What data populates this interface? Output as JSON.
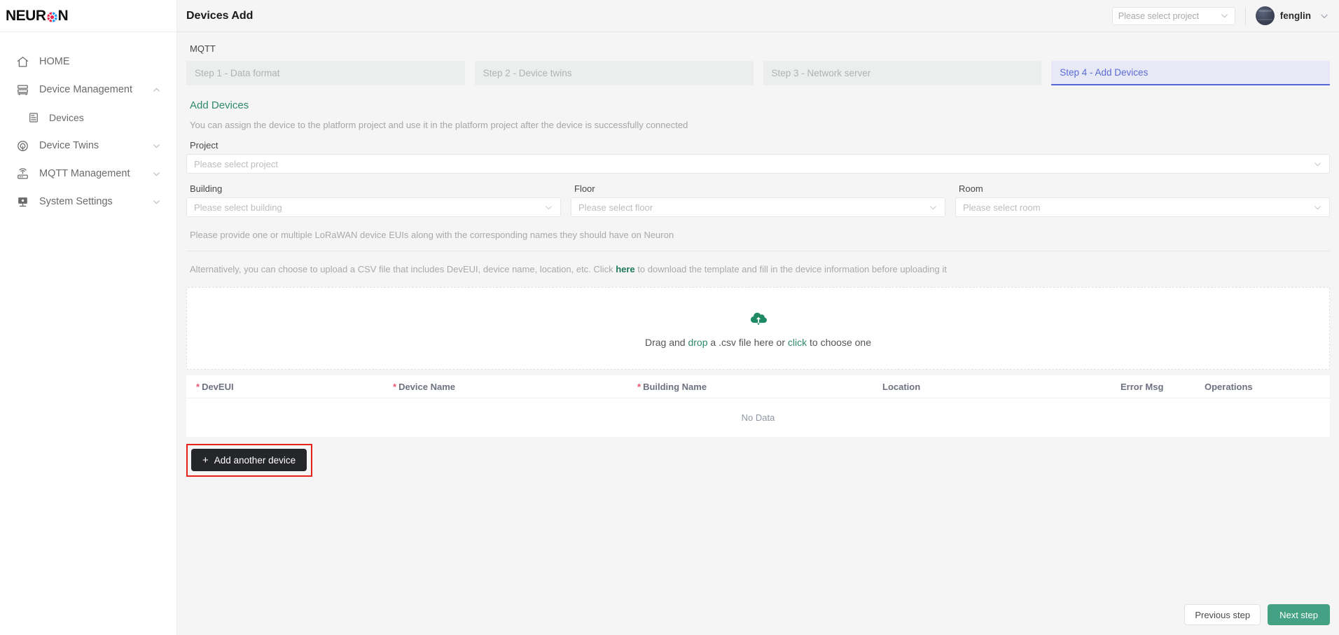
{
  "brand": {
    "name_part1": "NEUR",
    "name_part2": "N",
    "logo_icon": "neuron-logo"
  },
  "sidebar": {
    "items": [
      {
        "label": "HOME",
        "icon": "home-icon",
        "chevron": "",
        "sub": false
      },
      {
        "label": "Device Management",
        "icon": "server-icon",
        "chevron": "chevron-up-icon",
        "sub": false
      },
      {
        "label": "Devices",
        "icon": "device-icon",
        "chevron": "",
        "sub": true
      },
      {
        "label": "Device Twins",
        "icon": "twins-icon",
        "chevron": "chevron-down-icon",
        "sub": false
      },
      {
        "label": "MQTT Management",
        "icon": "router-icon",
        "chevron": "chevron-down-icon",
        "sub": false
      },
      {
        "label": "System Settings",
        "icon": "monitor-icon",
        "chevron": "chevron-down-icon",
        "sub": false
      }
    ]
  },
  "topbar": {
    "title": "Devices Add",
    "project_select_value": "Please select project",
    "project_select_icon": "chevron-down-icon",
    "user_name": "fenglin",
    "user_chevron_icon": "chevron-down-icon",
    "avatar_icon": "avatar"
  },
  "breadcrumb": {
    "label": "MQTT"
  },
  "stepper": {
    "steps": [
      {
        "label": "Step 1 - Data format",
        "active": false
      },
      {
        "label": "Step 2 - Device twins",
        "active": false
      },
      {
        "label": "Step 3 - Network server",
        "active": false
      },
      {
        "label": "Step 4 - Add Devices",
        "active": true
      }
    ],
    "active_bg": "#e7e9f7",
    "active_color": "#5b6cd4",
    "active_border": "#5566d6"
  },
  "section": {
    "title": "Add Devices",
    "title_color": "#2f8a6a",
    "description": "You can assign the device to the platform project and use it in the platform project after the device is successfully connected"
  },
  "form": {
    "project": {
      "label": "Project",
      "placeholder": "Please select project"
    },
    "building": {
      "label": "Building",
      "placeholder": "Please select building"
    },
    "floor": {
      "label": "Floor",
      "placeholder": "Please select floor"
    },
    "room": {
      "label": "Room",
      "placeholder": "Please select room"
    }
  },
  "hints": {
    "line1": "Please provide one or multiple LoRaWAN device EUIs along with the corresponding names they should have on Neuron",
    "line2_before": "Alternatively, you can choose to upload a CSV file that includes DevEUI, device name, location, etc. Click",
    "line2_link": "here",
    "line2_after": "to download the template and fill in the device information before uploading it"
  },
  "dropzone": {
    "icon": "cloud-upload-icon",
    "icon_color": "#1f8a63",
    "text_before": "Drag and ",
    "text_link1": "drop",
    "text_middle": " a .csv file here or ",
    "text_link2": "click",
    "text_after": " to choose one"
  },
  "table": {
    "columns": [
      {
        "label": "DevEUI",
        "required": true
      },
      {
        "label": "Device Name",
        "required": true
      },
      {
        "label": "Building Name",
        "required": true
      },
      {
        "label": "Location",
        "required": false
      },
      {
        "label": "Error Msg",
        "required": false
      },
      {
        "label": "Operations",
        "required": false
      }
    ],
    "empty_text": "No Data",
    "rows": []
  },
  "actions": {
    "add_another_device": "Add another device",
    "add_icon": "plus-icon",
    "highlight_color": "#e8201c",
    "previous_step": "Previous step",
    "next_step": "Next step",
    "next_color": "#44a183"
  }
}
